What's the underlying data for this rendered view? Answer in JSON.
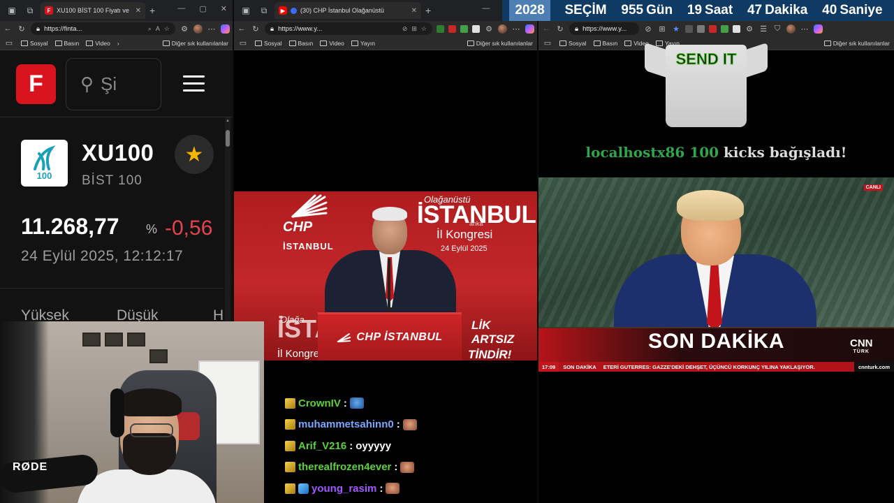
{
  "countdown": {
    "year": "2028",
    "event": "SEÇİM",
    "days": "955",
    "days_label": "Gün",
    "hours": "19",
    "hours_label": "Saat",
    "minutes": "47",
    "minutes_label": "Dakika",
    "seconds": "40",
    "seconds_label": "Saniye"
  },
  "window1": {
    "tab_title": "XU100 BİST 100 Fiyatı ve",
    "url": "https://finta...",
    "bookmarks": [
      "Sosyal",
      "Basın",
      "Video"
    ],
    "bookmarks_other": "Diğer sık kullanılanlar",
    "page": {
      "logo_letter": "F",
      "search_placeholder": "Şi",
      "symbol": "XU100",
      "index_logo_number": "100",
      "index_name": "BİST 100",
      "price": "11.268,77",
      "percent_sign": "%",
      "change": "-0,56",
      "datetime": "24 Eylül 2025, 12:12:17",
      "col_high": "Yüksek",
      "col_low": "Düşük",
      "col_third": "H"
    }
  },
  "window2": {
    "tab_title": "(30) CHP İstanbul Olağanüstü",
    "url": "https://www.y...",
    "bookmarks": [
      "Sosyal",
      "Basın",
      "Video",
      "Yayın"
    ],
    "bookmarks_other": "Diğer sık kullanılanlar",
    "video": {
      "party": "CHP",
      "city": "İSTANBUL",
      "top_line": "Olağanüstü",
      "big_city": "İSTANBUL",
      "congress": "İl Kongresi",
      "congress_date": "24 Eylül 2025",
      "agency": "anka",
      "podium_text": "CHP İSTANBUL",
      "left_top": "Olağa",
      "left_big": "İSTA",
      "left_bottom": "İl Kongre",
      "right_1": "LİK",
      "right_2": "ARTSIZ",
      "right_3": "TİNDİR!"
    }
  },
  "window3": {
    "url": "https://www.y...",
    "bookmarks": [
      "Sosyal",
      "Basın",
      "Video",
      "Yayın"
    ],
    "bookmarks_other": "Diğer sık kullanılanlar",
    "tshirt_text": "SEND IT",
    "donation": {
      "user": "localhostx86",
      "amount": "100",
      "text": "kicks bağışladı!"
    },
    "news": {
      "live_label": "CANLI",
      "breaking": "SON DAKİKA",
      "channel": "CNN",
      "channel_sub": "TÜRK",
      "ticker_time": "17:09",
      "ticker_label": "SON DAKİKA",
      "ticker_text": "ETERİ GUTERRES: GAZZE'DEKİ DEHŞET, ÜÇÜNCÜ KORKUNÇ YILINA YAKLAŞIYOR.",
      "ticker_site": "cnnturk.com"
    }
  },
  "webcam": {
    "mic_brand": "RØDE"
  },
  "chat": [
    {
      "user": "CrownIV",
      "color": "#5bd13a",
      "message": "",
      "emote": "blue"
    },
    {
      "user": "muhammetsahinn0",
      "color": "#7aa8ff",
      "message": "",
      "emote": "face"
    },
    {
      "user": "Arif_V216",
      "color": "#5bd13a",
      "message": "oyyyyy",
      "emote": ""
    },
    {
      "user": "therealfrozen4ever",
      "color": "#5bd13a",
      "message": "",
      "emote": "face"
    },
    {
      "user": "young_rasim",
      "color": "#a259ff",
      "message": "",
      "emote": "face"
    }
  ],
  "colors": {
    "accent_red": "#d9141f",
    "negative": "#e5434d",
    "star": "#f4b400",
    "countdown_bg": "#0e3a63"
  }
}
